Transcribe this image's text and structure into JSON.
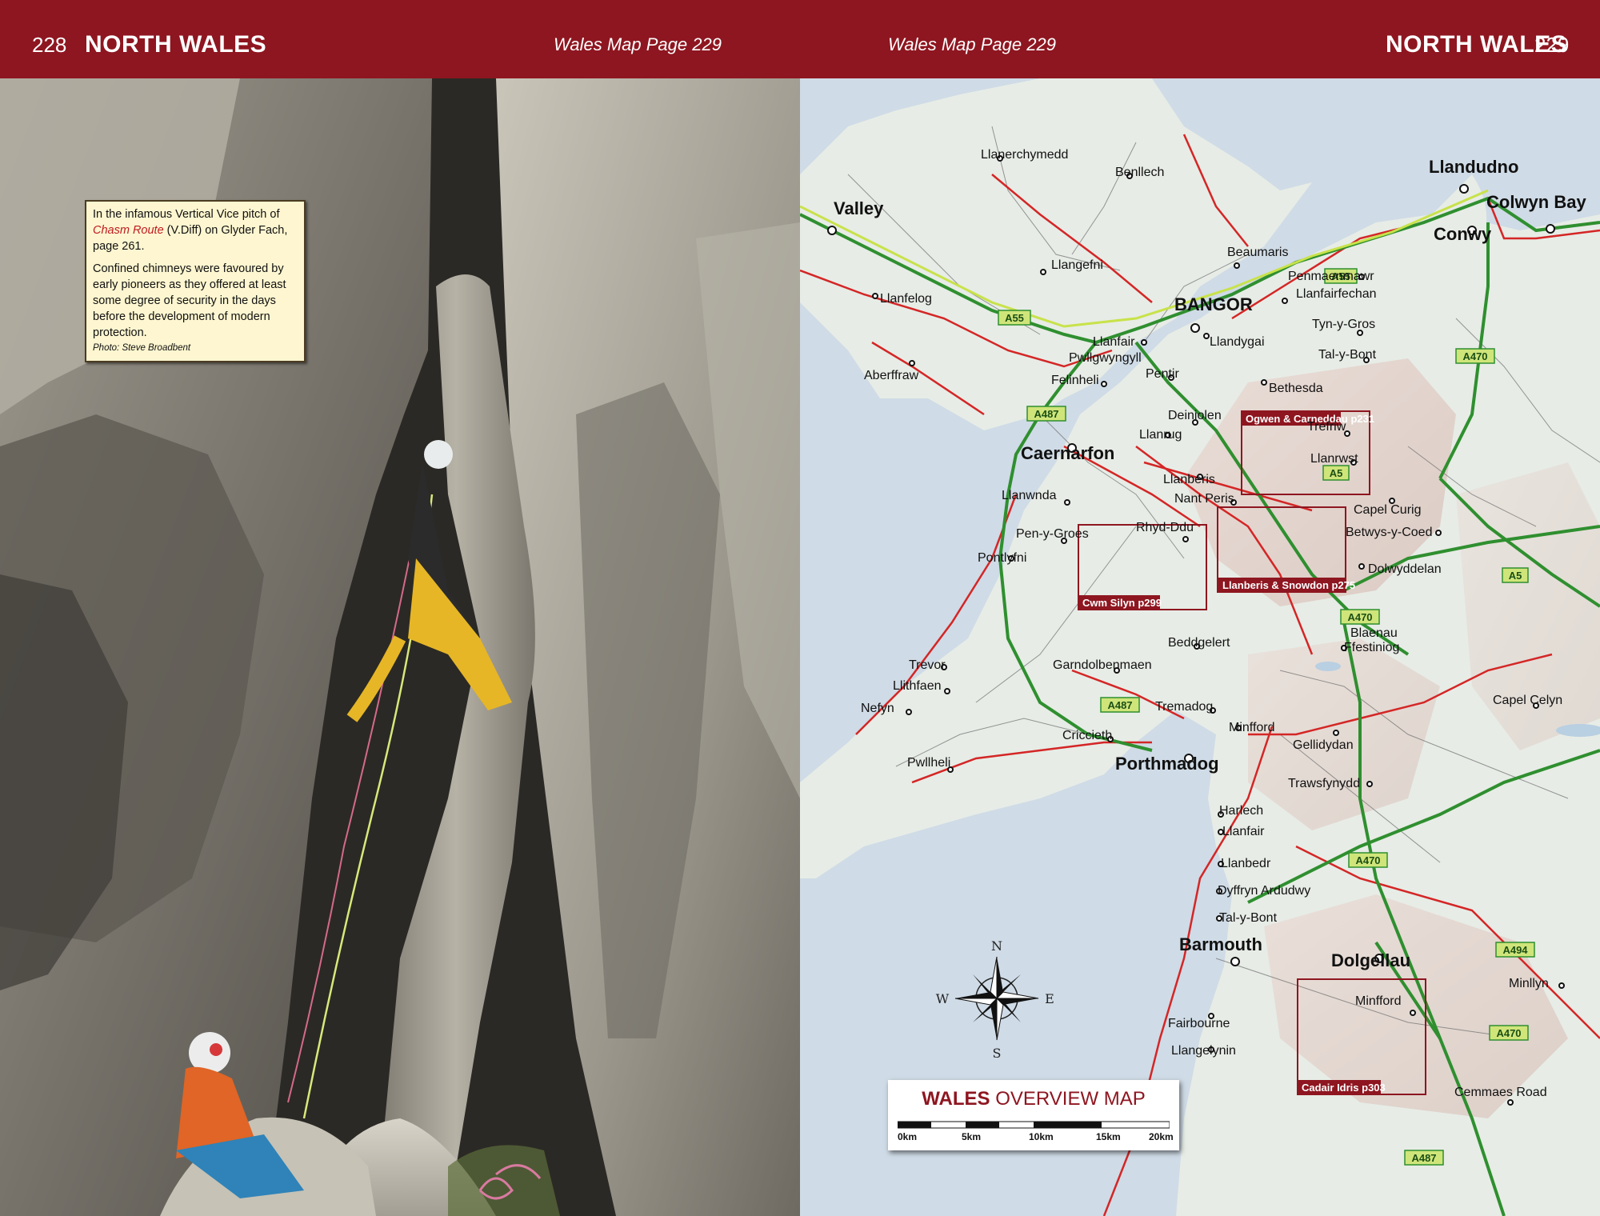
{
  "header": {
    "left_page_number": "228",
    "left_section": "NORTH WALES",
    "left_map_ref": "Wales Map Page 229",
    "right_map_ref": "Wales Map Page 229",
    "right_section": "NORTH WALES",
    "right_page_number": "229"
  },
  "caption": {
    "line_intro": "In the infamous Vertical Vice pitch of ",
    "route_name": "Chasm Route",
    "grade": " (V.Diff)",
    "line_end": " on Glyder Fach, page 261.",
    "paragraph2": "Confined chimneys were favoured by early pioneers as they offered at least some degree of security in the days before the development of modern protection.",
    "credit": "Photo: Steve Broadbent"
  },
  "map": {
    "places": [
      {
        "name": "Llanerchymedd"
      },
      {
        "name": "Benllech"
      },
      {
        "name": "Llandudno"
      },
      {
        "name": "Valley"
      },
      {
        "name": "Colwyn Bay"
      },
      {
        "name": "Conwy"
      },
      {
        "name": "Llangefni"
      },
      {
        "name": "Beaumaris"
      },
      {
        "name": "Penmaenmawr"
      },
      {
        "name": "Llanfelog"
      },
      {
        "name": "BANGOR"
      },
      {
        "name": "Llanfairfechan"
      },
      {
        "name": "Llanfair"
      },
      {
        "name": "Pwllgwyngyll"
      },
      {
        "name": "Llandygai"
      },
      {
        "name": "Tyn-y-Gros"
      },
      {
        "name": "Aberffraw"
      },
      {
        "name": "Pentir"
      },
      {
        "name": "Tal-y-Bont"
      },
      {
        "name": "Felinheli"
      },
      {
        "name": "Bethesda"
      },
      {
        "name": "Deiniolen"
      },
      {
        "name": "Trefriw"
      },
      {
        "name": "Llanrug"
      },
      {
        "name": "Caernarfon"
      },
      {
        "name": "Llanrwst"
      },
      {
        "name": "Llanberis"
      },
      {
        "name": "Nant Peris"
      },
      {
        "name": "Llanwnda"
      },
      {
        "name": "Capel Curig"
      },
      {
        "name": "Betwys-y-Coed"
      },
      {
        "name": "Rhyd-Ddu"
      },
      {
        "name": "Pen-y-Groes"
      },
      {
        "name": "Pontlyfni"
      },
      {
        "name": "Dolwyddelan"
      },
      {
        "name": "Beddgelert"
      },
      {
        "name": "Blaenau"
      },
      {
        "name": "Ffestiniog"
      },
      {
        "name": "Trevor"
      },
      {
        "name": "Garndolbenmaen"
      },
      {
        "name": "Llithfaen"
      },
      {
        "name": "Capel Celyn"
      },
      {
        "name": "Nefyn"
      },
      {
        "name": "Tremadog"
      },
      {
        "name": "Minfford"
      },
      {
        "name": "Criccieth"
      },
      {
        "name": "Gellidydan"
      },
      {
        "name": "Pwllheli"
      },
      {
        "name": "Porthmadog"
      },
      {
        "name": "Trawsfynydd"
      },
      {
        "name": "Harlech"
      },
      {
        "name": "Llanfair"
      },
      {
        "name": "Llanbedr"
      },
      {
        "name": "Dyffryn Ardudwy"
      },
      {
        "name": "Tal-y-Bont"
      },
      {
        "name": "Barmouth"
      },
      {
        "name": "Dolgellau"
      },
      {
        "name": "Minllyn"
      },
      {
        "name": "Minfford"
      },
      {
        "name": "Fairbourne"
      },
      {
        "name": "Llangelynin"
      },
      {
        "name": "Cemmaes Road"
      }
    ],
    "roads": [
      "A55",
      "A55",
      "A470",
      "A487",
      "A5",
      "A5",
      "A470",
      "A487",
      "A470",
      "A494",
      "A470",
      "A487"
    ],
    "areas": [
      {
        "label": "Ogwen & Carneddau p231"
      },
      {
        "label": "Llanberis & Snowdon p275"
      },
      {
        "label": "Cwm Silyn p299"
      },
      {
        "label": "Cadair Idris p303"
      }
    ],
    "compass": {
      "n": "N",
      "e": "E",
      "s": "S",
      "w": "W"
    },
    "legend": {
      "title_bold": "WALES",
      "title_rest": " OVERVIEW MAP",
      "scale": [
        "0km",
        "5km",
        "10km",
        "15km",
        "20km"
      ]
    }
  }
}
